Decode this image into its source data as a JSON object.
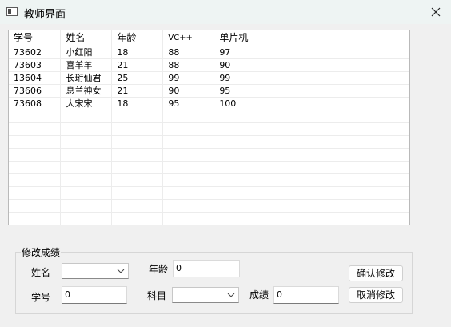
{
  "window": {
    "title": "教师界面",
    "close_glyph": "✕"
  },
  "table": {
    "headers": [
      "学号",
      "姓名",
      "年龄",
      "VC++",
      "单片机"
    ],
    "rows": [
      [
        "73602",
        "小红阳",
        "18",
        "88",
        "97"
      ],
      [
        "73603",
        "喜羊羊",
        "21",
        "88",
        "90"
      ],
      [
        "13604",
        "长珩仙君",
        "25",
        "99",
        "99"
      ],
      [
        "73606",
        "息兰神女",
        "21",
        "90",
        "95"
      ],
      [
        "73608",
        "大宋宋",
        "18",
        "95",
        "100"
      ]
    ]
  },
  "form": {
    "group_title": "修改成绩",
    "name_label": "姓名",
    "name_value": "",
    "age_label": "年龄",
    "age_value": "0",
    "id_label": "学号",
    "id_value": "0",
    "subject_label": "科目",
    "subject_value": "",
    "score_label": "成绩",
    "score_value": "0",
    "confirm_label": "确认修改",
    "cancel_label": "取消修改"
  }
}
